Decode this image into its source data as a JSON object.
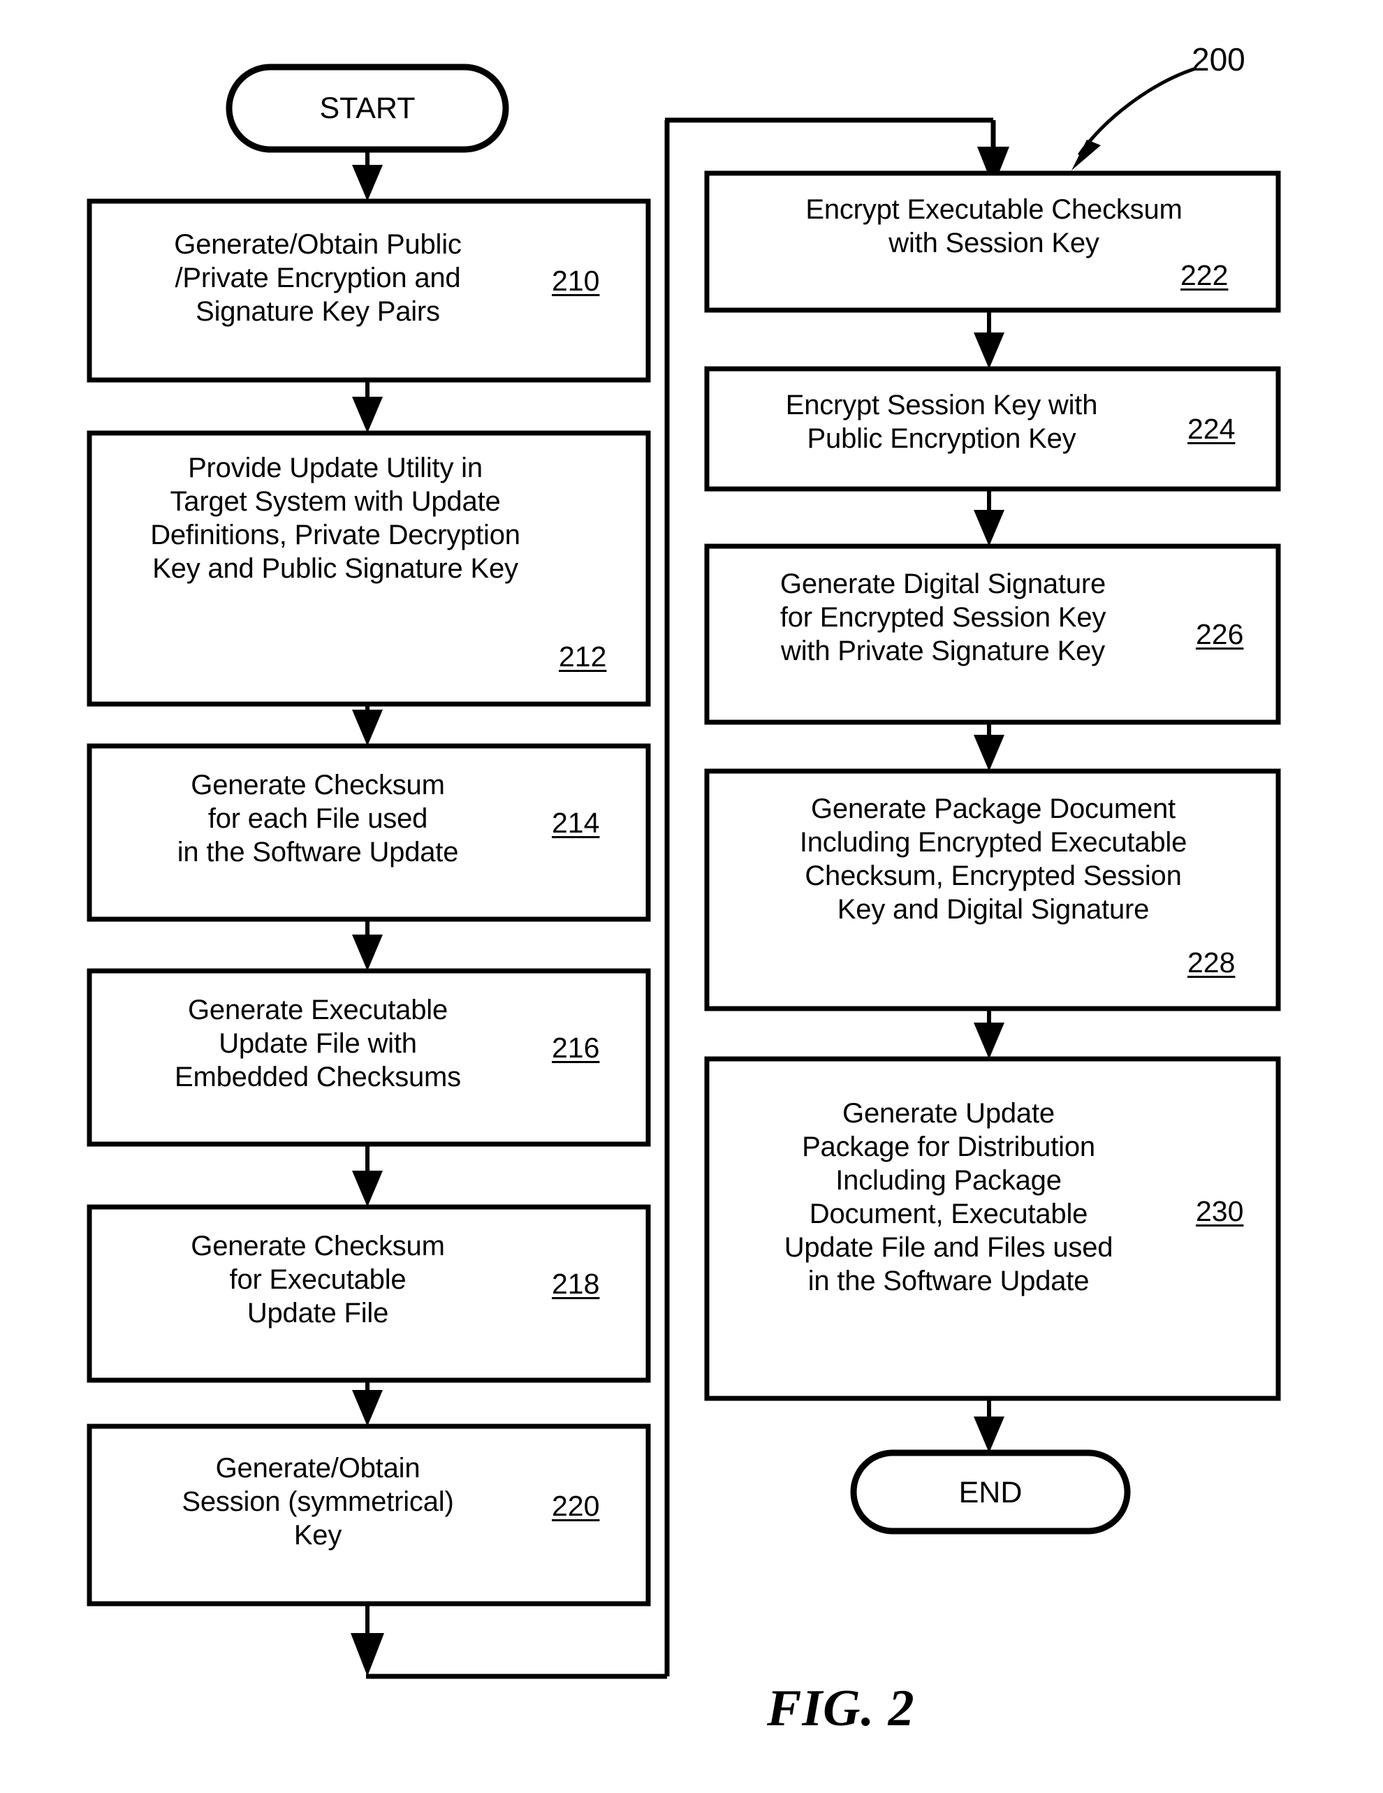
{
  "figure": {
    "caption": "FIG. 2",
    "diagram_reference": "200"
  },
  "terminals": {
    "start": "START",
    "end": "END"
  },
  "flowchart": {
    "type": "process-flowchart",
    "title": "FIG. 2",
    "columns": [
      {
        "name": "left-column",
        "steps": [
          {
            "ref": "210",
            "text": "Generate/Obtain Public\n/Private Encryption and\nSignature Key Pairs",
            "ref_position": "right-middle"
          },
          {
            "ref": "212",
            "text": "Provide Update Utility in\nTarget System with Update\nDefinitions, Private Decryption\nKey and Public Signature Key",
            "ref_position": "bottom-right"
          },
          {
            "ref": "214",
            "text": "Generate Checksum\nfor each File used\nin the Software Update",
            "ref_position": "right-middle"
          },
          {
            "ref": "216",
            "text": "Generate Executable\nUpdate File with\nEmbedded Checksums",
            "ref_position": "right-middle"
          },
          {
            "ref": "218",
            "text": "Generate Checksum\nfor Executable\nUpdate File",
            "ref_position": "right-middle"
          },
          {
            "ref": "220",
            "text": "Generate/Obtain\nSession (symmetrical)\nKey",
            "ref_position": "right-middle"
          }
        ]
      },
      {
        "name": "right-column",
        "steps": [
          {
            "ref": "222",
            "text": "Encrypt Executable Checksum\nwith Session Key",
            "ref_position": "bottom-right"
          },
          {
            "ref": "224",
            "text": "Encrypt Session Key with\nPublic Encryption Key",
            "ref_position": "right-middle"
          },
          {
            "ref": "226",
            "text": "Generate Digital Signature\nfor Encrypted Session Key\nwith Private Signature Key",
            "ref_position": "right-middle"
          },
          {
            "ref": "228",
            "text": "Generate Package Document\nIncluding Encrypted Executable\nChecksum, Encrypted Session\nKey and Digital Signature",
            "ref_position": "bottom-right"
          },
          {
            "ref": "230",
            "text": "Generate Update\nPackage for Distribution\nIncluding Package\nDocument, Executable\nUpdate File and Files used\nin the Software Update",
            "ref_position": "right-middle"
          }
        ]
      }
    ],
    "connector_note": "Flow proceeds START → 210 → 212 → 214 → 216 → 218 → 220, then wraps via a bottom-and-right routed connector up to 222 → 224 → 226 → 228 → 230 → END.",
    "colors": {
      "stroke": "#000000",
      "fill": "#ffffff",
      "text": "#000000"
    }
  }
}
